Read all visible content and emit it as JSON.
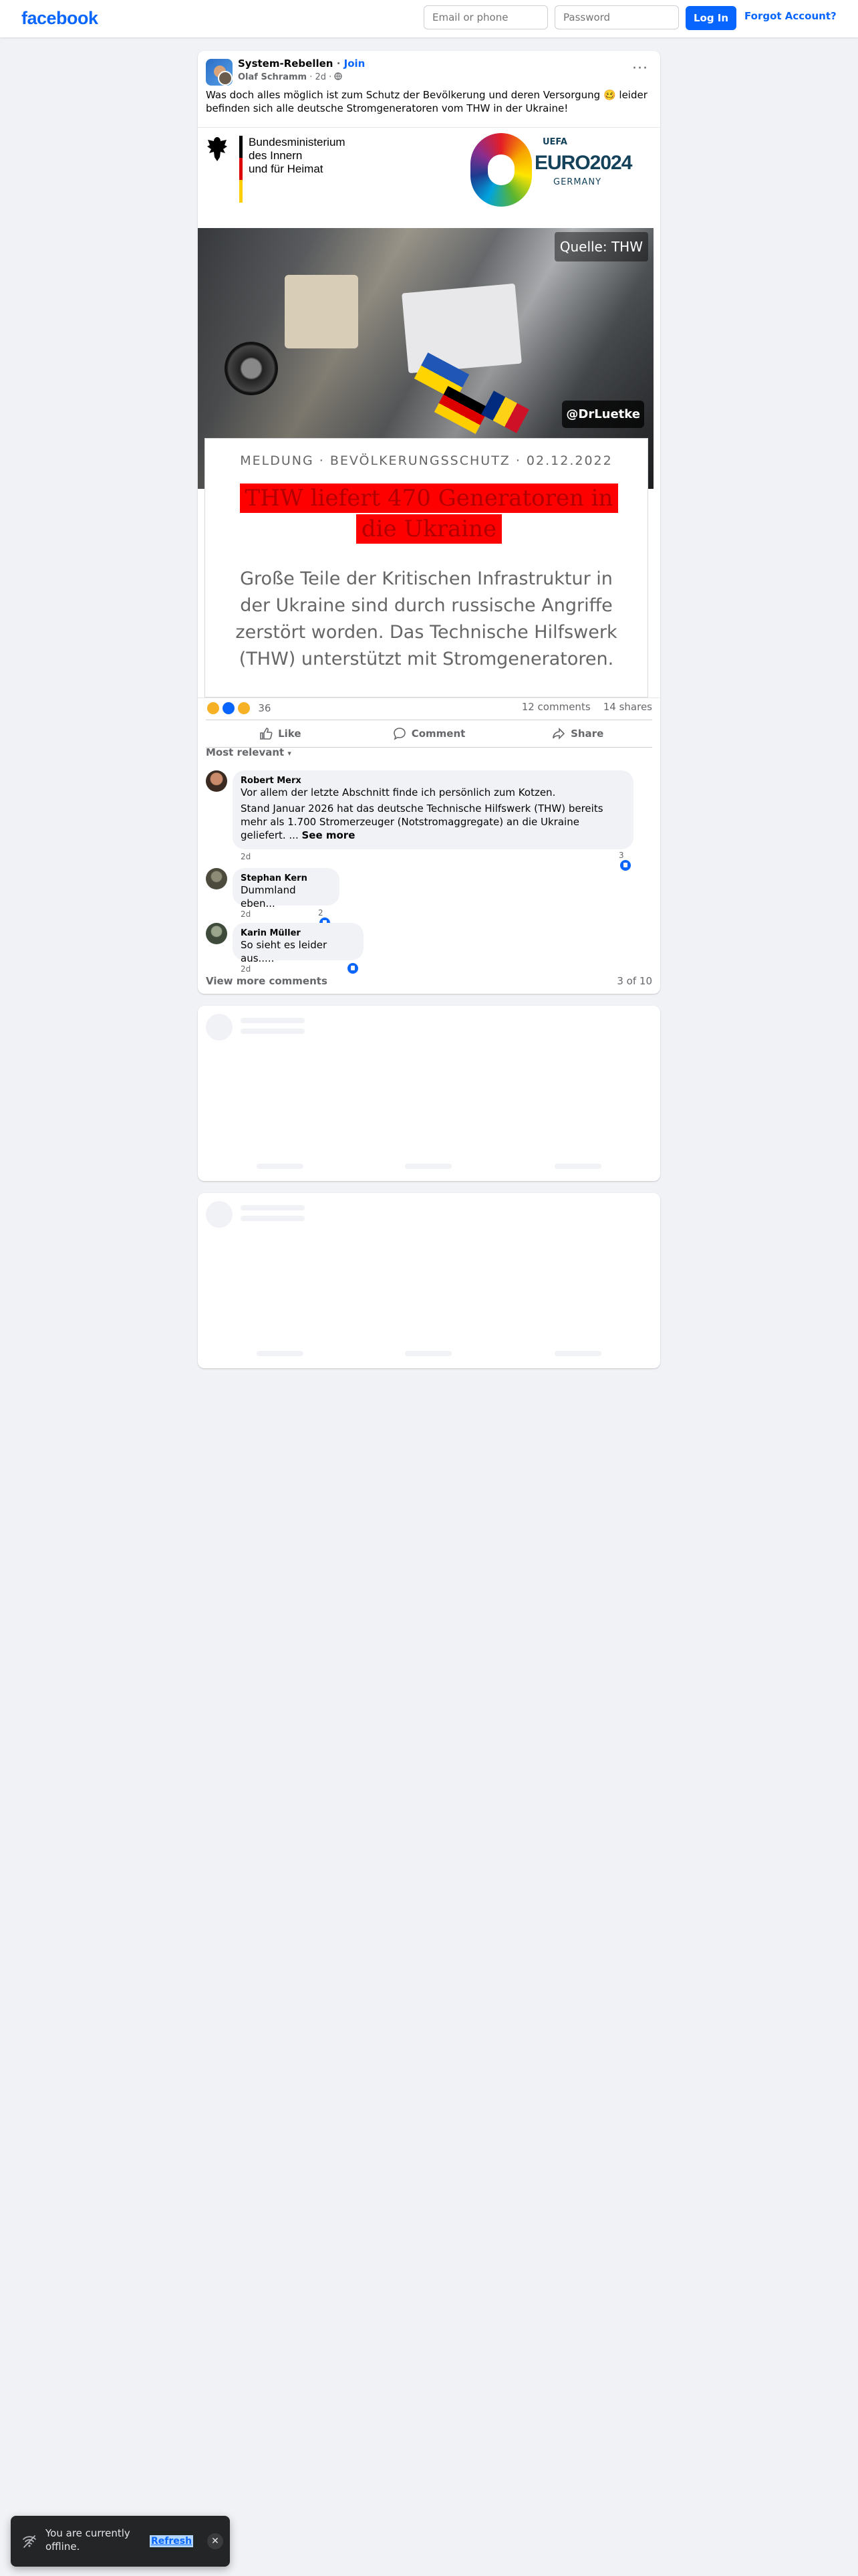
{
  "header": {
    "logo": "facebook",
    "email_placeholder": "Email or phone",
    "password_placeholder": "Password",
    "login_label": "Log In",
    "forgot_label": "Forgot Account?"
  },
  "post": {
    "group_name": "System-Rebellen",
    "join_label": "Join",
    "author": "Olaf Schramm",
    "time": "2d",
    "text": "Was doch alles möglich ist zum Schutz der Bevölkerung und deren Versorgung 🥴 leider befinden sich alle deutsche Stromgeneratoren vom THW in der Ukraine!",
    "image": {
      "ministry_text": "Bundesministerium\ndes Innern\nund für Heimat",
      "uefa_label": "UEFA",
      "euro_label": "EURO2024",
      "germany_label": "GERMANY",
      "source_label": "Quelle: THW",
      "handle_label": "@DrLuetke",
      "category_line": "MELDUNG · BEVÖLKERUNGSSCHUTZ · 02.12.2022",
      "headline": "THW liefert 470 Generatoren in die Ukraine",
      "lead": "Große Teile der Kritischen Infrastruktur in der Ukraine sind durch russische Angriffe zerstört worden. Das Technische Hilfswerk (THW) unterstützt mit Stromgeneratoren."
    },
    "reaction_count": "36",
    "comments_count": "12 comments",
    "shares_count": "14 shares",
    "actions": {
      "like": "Like",
      "comment": "Comment",
      "share": "Share"
    },
    "sort_label": "Most relevant"
  },
  "comments": [
    {
      "name": "Robert Merx",
      "text": "Vor allem der letzte Abschnitt finde ich persönlich zum Kotzen.",
      "text2": "Stand Januar 2026 hat das deutsche Technische Hilfswerk (THW) bereits mehr als 1.700 Stromerzeuger (Notstromaggregate) an die Ukraine geliefert. ...",
      "see_more": "See more",
      "time": "2d",
      "likes": "3"
    },
    {
      "name": "Stephan Kern",
      "text": "Dummland eben...",
      "time": "2d",
      "likes": "2"
    },
    {
      "name": "Karin Müller",
      "text": "So sieht es leider aus.....",
      "time": "2d",
      "likes": ""
    }
  ],
  "view_more_comments": "View more comments",
  "comments_page": "3 of 10",
  "toast": {
    "message": "You are currently offline.",
    "refresh_label": "Refresh"
  }
}
